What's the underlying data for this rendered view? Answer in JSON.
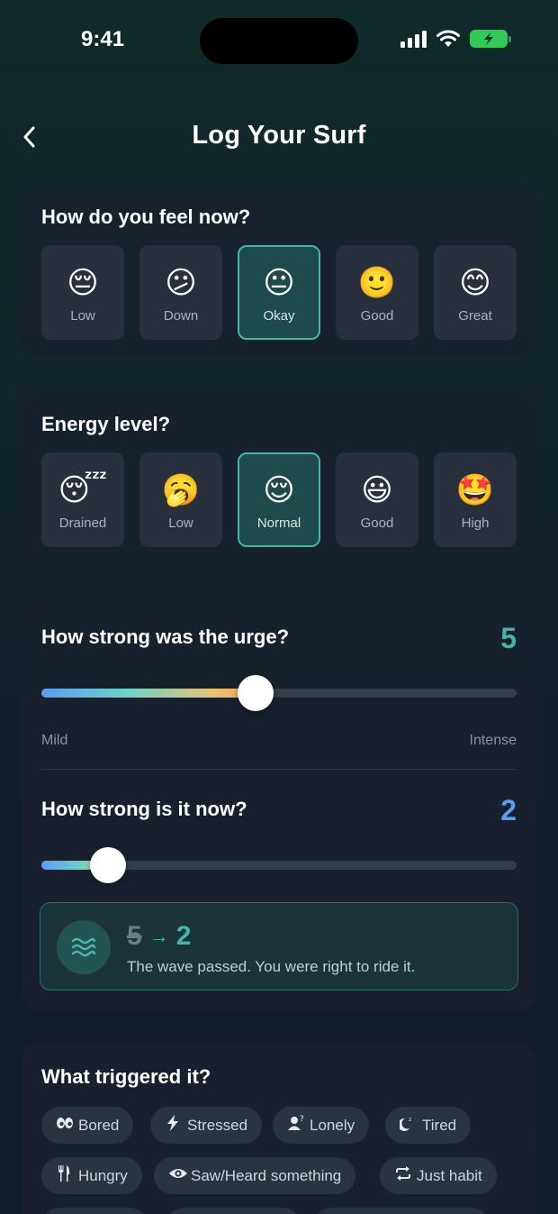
{
  "status": {
    "time": "9:41"
  },
  "header": {
    "title": "Log Your Surf"
  },
  "feel": {
    "title": "How do you feel now?",
    "selected": "Okay",
    "options": [
      {
        "label": "Low",
        "emoji": "😔"
      },
      {
        "label": "Down",
        "emoji": "😕"
      },
      {
        "label": "Okay",
        "emoji": "😐"
      },
      {
        "label": "Good",
        "emoji": "🙂"
      },
      {
        "label": "Great",
        "emoji": "😊"
      }
    ]
  },
  "energy": {
    "title": "Energy level?",
    "selected": "Normal",
    "options": [
      {
        "label": "Drained",
        "emoji": "😴"
      },
      {
        "label": "Low",
        "emoji": "🥱"
      },
      {
        "label": "Normal",
        "emoji": "😌"
      },
      {
        "label": "Good",
        "emoji": "😃"
      },
      {
        "label": "High",
        "emoji": "🤩"
      }
    ]
  },
  "urge": {
    "title": "How strong was the urge?",
    "value": "5",
    "value_color": "#47b4a6",
    "level_fraction": 0.45,
    "min_label": "Mild",
    "max_label": "Intense"
  },
  "now": {
    "title": "How strong is it now?",
    "value": "2",
    "value_color": "#5b9df0",
    "level_fraction": 0.14
  },
  "result": {
    "from": "5",
    "arrow": "→",
    "to": "2",
    "message": "The wave passed. You were right to ride it.",
    "icon": "waves-icon"
  },
  "triggers": {
    "title": "What triggered it?",
    "chips": [
      {
        "label": "Bored",
        "icon": "eyes-icon"
      },
      {
        "label": "Stressed",
        "icon": "bolt-icon"
      },
      {
        "label": "Lonely",
        "icon": "person-question-icon"
      },
      {
        "label": "Tired",
        "icon": "moon-zzz-icon"
      },
      {
        "label": "Hungry",
        "icon": "fork-knife-icon"
      },
      {
        "label": "Saw/Heard something",
        "icon": "eye-icon"
      },
      {
        "label": "Just habit",
        "icon": "repeat-icon"
      }
    ]
  },
  "colors": {
    "accent_teal": "#47b4a6",
    "accent_blue": "#5b9df0",
    "card_bg": "#19212d"
  }
}
